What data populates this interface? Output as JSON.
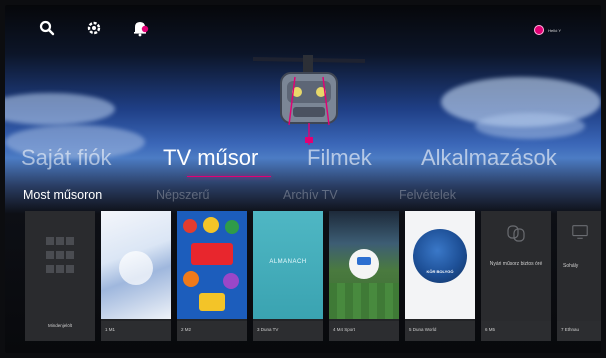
{
  "topbar": {
    "icons": [
      "search-icon",
      "settings-icon",
      "notification-bell-icon"
    ],
    "profile_name": "Helló Y"
  },
  "main_nav": {
    "items": [
      {
        "label": "Saját fiók",
        "active": false
      },
      {
        "label": "TV műsor",
        "active": true
      },
      {
        "label": "Filmek",
        "active": false
      },
      {
        "label": "Alkalmazások",
        "active": false
      }
    ]
  },
  "sub_nav": {
    "items": [
      {
        "label": "Most műsoron",
        "active": true
      },
      {
        "label": "Népszerű",
        "active": false
      },
      {
        "label": "Archív TV",
        "active": false
      },
      {
        "label": "Felvételek",
        "active": false
      }
    ]
  },
  "tiles": [
    {
      "label": "Mindenjelölt",
      "kind": "all-channels"
    },
    {
      "label": "1 M1",
      "kind": "channel"
    },
    {
      "label": "2 M2",
      "kind": "channel"
    },
    {
      "label": "3 Duna TV",
      "kind": "channel",
      "thumb_text": "ALMANACH"
    },
    {
      "label": "4 M4 Sport",
      "kind": "channel"
    },
    {
      "label": "5 Duna World",
      "kind": "channel",
      "thumb_text": "KÖR BOLYGÓ"
    },
    {
      "label": "6 M5",
      "kind": "channel",
      "thumb_text": "Nyári műsorz biztos óré"
    },
    {
      "label": "7 Ethnau",
      "kind": "channel",
      "thumb_text": "Sohály"
    }
  ],
  "colors": {
    "accent": "#e20074",
    "background": "#08090c",
    "sky": "#3b67b8"
  }
}
